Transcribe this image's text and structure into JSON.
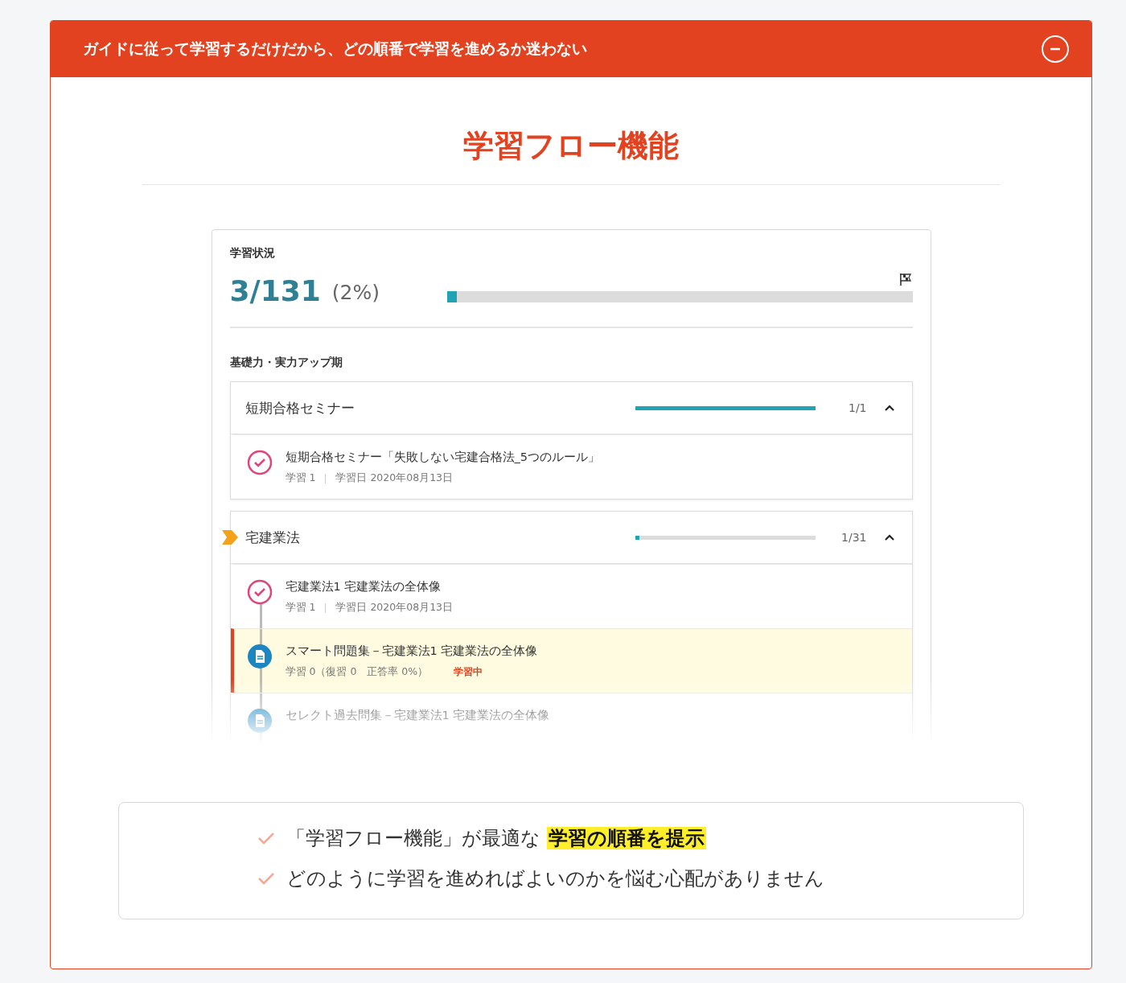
{
  "banner": {
    "title": "ガイドに従って学習するだけだから、どの順番で学習を進めるか迷わない",
    "expanded": true
  },
  "heading": "学習フロー機能",
  "app": {
    "status_label": "学習状況",
    "progress_count": "3/131",
    "progress_percent": "(2%)",
    "level": 0.02,
    "phase_label": "基礎力・実力アップ期",
    "sections": [
      {
        "title": "短期合格セミナー",
        "current": false,
        "level": 1,
        "count": "1/1",
        "expanded": true,
        "items": [
          {
            "kind": "done",
            "selected": false,
            "title": "短期合格セミナー「失敗しない宅建合格法_5つのルール」",
            "meta": "学習 1",
            "date": "学習日 2020年08月13日"
          }
        ]
      },
      {
        "title": "宅建業法",
        "current": true,
        "level": 0.02,
        "count": "1/31",
        "expanded": true,
        "items": [
          {
            "kind": "done",
            "selected": false,
            "title": "宅建業法1 宅建業法の全体像",
            "meta": "学習 1",
            "date": "学習日 2020年08月13日"
          },
          {
            "kind": "drill",
            "selected": true,
            "title": "スマート問題集－宅建業法1 宅建業法の全体像",
            "meta": "学習 0（復習 0　正答率 0%）",
            "status": "学習中"
          },
          {
            "kind": "drill",
            "selected": false,
            "title": "セレクト過去問集－宅建業法1 宅建業法の全体像"
          }
        ]
      }
    ]
  },
  "points": [
    {
      "text": "「学習フロー機能」が最適な",
      "highlight": "学習の順番を提示"
    },
    {
      "text": "どのように学習を進めればよいのかを悩む心配がありません"
    }
  ]
}
